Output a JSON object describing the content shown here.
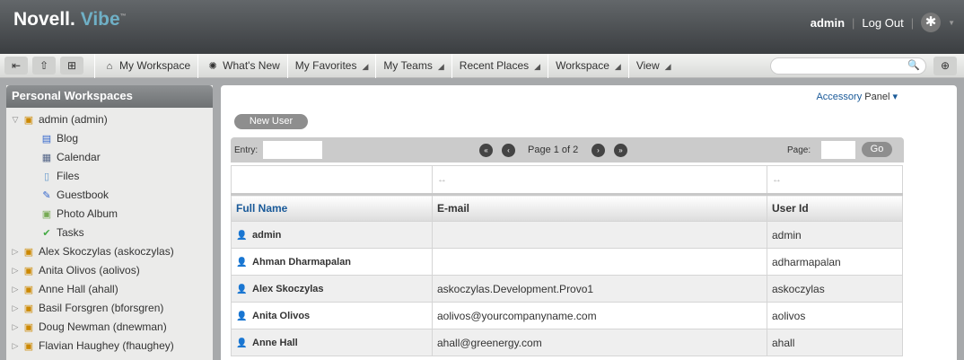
{
  "header": {
    "logo_main": "Novell",
    "logo_sub": "Vibe",
    "logo_tm": "™",
    "user": "admin",
    "logout": "Log Out"
  },
  "toolbar": {
    "nav": [
      {
        "label": "My Workspace",
        "arrow": false
      },
      {
        "label": "What's New",
        "arrow": false
      },
      {
        "label": "My Favorites",
        "arrow": true
      },
      {
        "label": "My Teams",
        "arrow": true
      },
      {
        "label": "Recent Places",
        "arrow": true
      },
      {
        "label": "Workspace",
        "arrow": true
      },
      {
        "label": "View",
        "arrow": true
      }
    ],
    "search_placeholder": ""
  },
  "sidebar": {
    "title": "Personal Workspaces",
    "root": "admin (admin)",
    "children": [
      "Blog",
      "Calendar",
      "Files",
      "Guestbook",
      "Photo Album",
      "Tasks"
    ],
    "others": [
      "Alex Skoczylas (askoczylas)",
      "Anita Olivos (aolivos)",
      "Anne Hall (ahall)",
      "Basil Forsgren (bforsgren)",
      "Doug Newman (dnewman)",
      "Flavian Haughey (fhaughey)"
    ]
  },
  "main": {
    "accessory": "Accessory",
    "accessory_panel": "Panel",
    "new_user": "New User",
    "entry_label": "Entry:",
    "page_text": "Page 1 of 2",
    "page_label": "Page:",
    "go": "Go",
    "columns": [
      "Full Name",
      "E-mail",
      "User Id"
    ],
    "rows": [
      [
        "admin",
        "",
        "admin"
      ],
      [
        "Ahman Dharmapalan",
        "",
        "adharmapalan"
      ],
      [
        "Alex Skoczylas",
        "askoczylas.Development.Provo1",
        "askoczylas"
      ],
      [
        "Anita Olivos",
        "aolivos@yourcompanyname.com",
        "aolivos"
      ],
      [
        "Anne Hall",
        "ahall@greenergy.com",
        "ahall"
      ]
    ]
  }
}
